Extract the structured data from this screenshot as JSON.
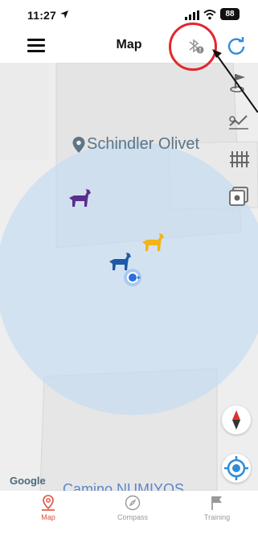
{
  "status_bar": {
    "time": "11:27",
    "battery": "88"
  },
  "header": {
    "title": "Map"
  },
  "map": {
    "place_label": "Schindler Olivet",
    "google_label": "Google",
    "street_label": "Camino NUMIYOS",
    "dog_colors": [
      "#5b2d8c",
      "#f2b418",
      "#1f59a8"
    ],
    "accent_color": "#e3262d"
  },
  "tabs": [
    {
      "label": "Map",
      "icon": "map-pin-icon",
      "active": true
    },
    {
      "label": "Compass",
      "icon": "compass-icon",
      "active": false
    },
    {
      "label": "Training",
      "icon": "flag-icon",
      "active": false
    }
  ]
}
